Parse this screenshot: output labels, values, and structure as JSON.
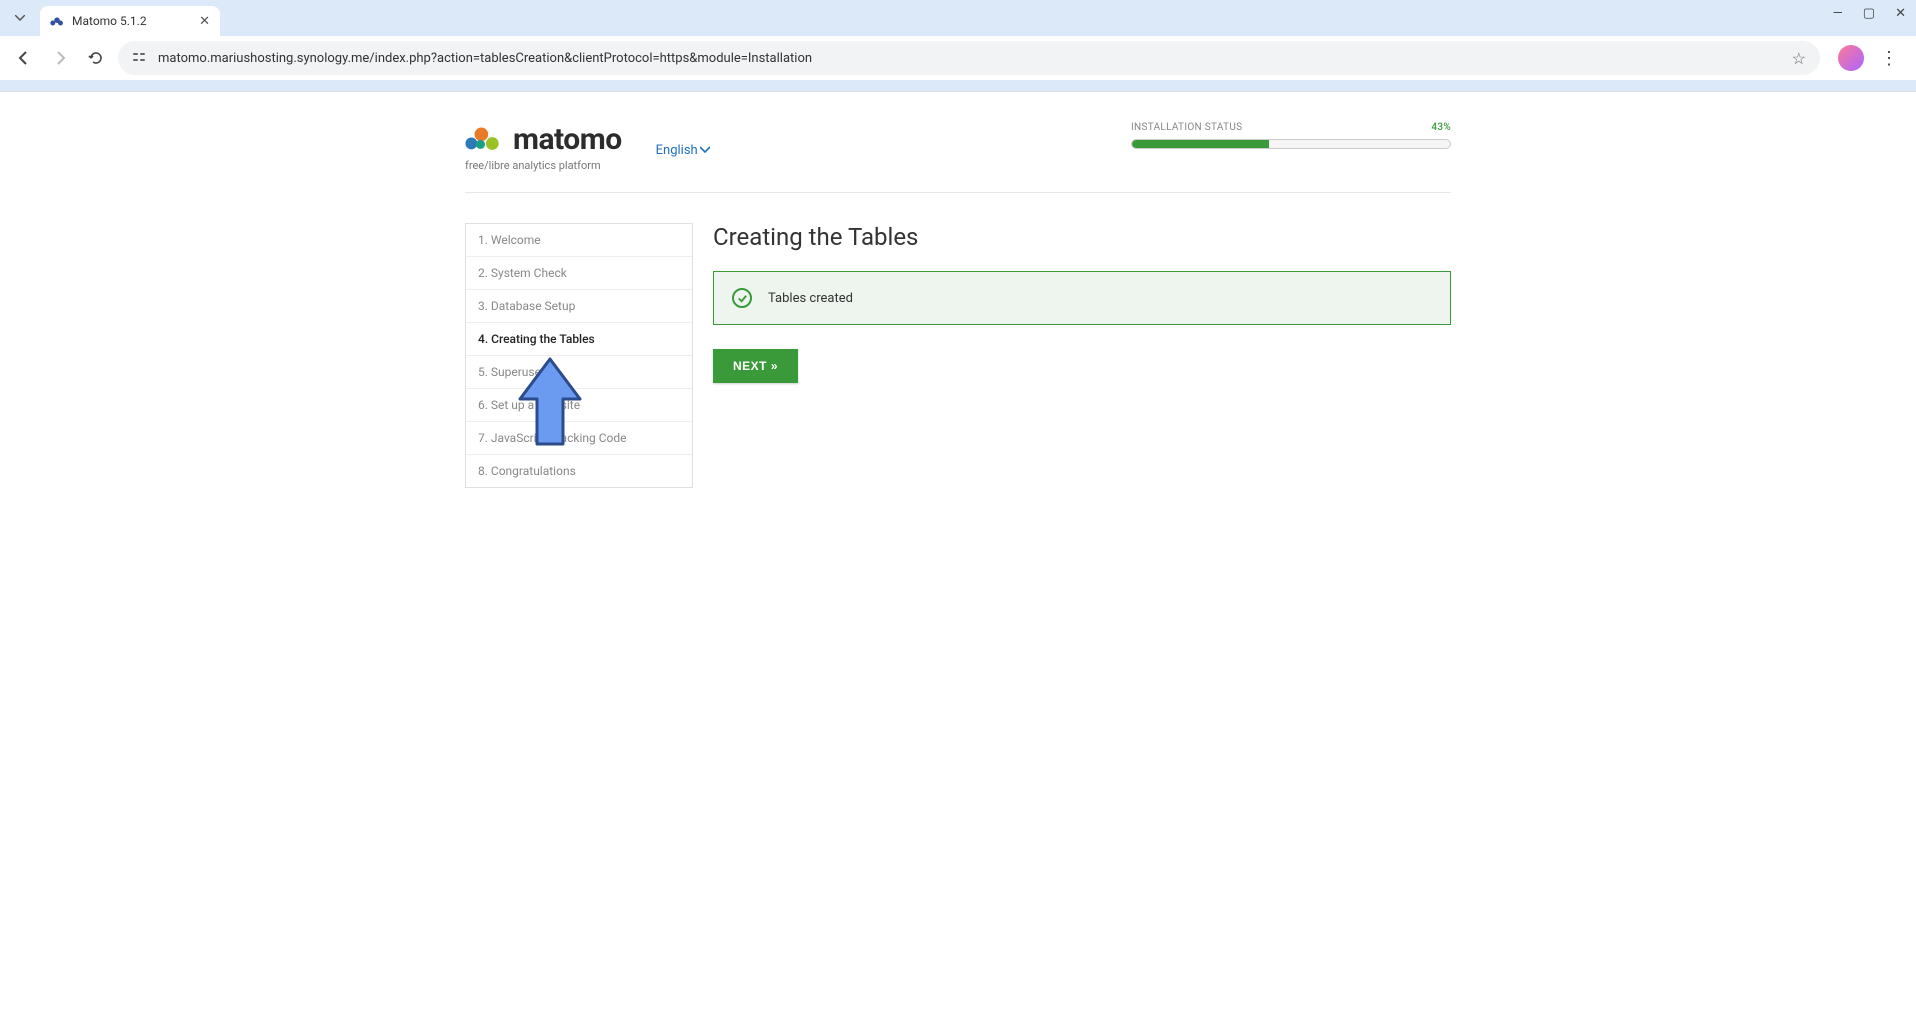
{
  "browser": {
    "tab_title": "Matomo 5.1.2",
    "url": "matomo.mariushosting.synology.me/index.php?action=tablesCreation&clientProtocol=https&module=Installation"
  },
  "header": {
    "brand": "matomo",
    "tagline": "free/libre analytics platform",
    "language": "English"
  },
  "status": {
    "label": "INSTALLATION STATUS",
    "percent_text": "43%",
    "percent_value": 43
  },
  "sidebar": {
    "items": [
      {
        "label": "1. Welcome",
        "active": false
      },
      {
        "label": "2. System Check",
        "active": false
      },
      {
        "label": "3. Database Setup",
        "active": false
      },
      {
        "label": "4. Creating the Tables",
        "active": true
      },
      {
        "label": "5. Superuser",
        "active": false
      },
      {
        "label": "6. Set up a Website",
        "active": false
      },
      {
        "label": "7. JavaScript Tracking Code",
        "active": false
      },
      {
        "label": "8. Congratulations",
        "active": false
      }
    ]
  },
  "main": {
    "title": "Creating the Tables",
    "success_message": "Tables created",
    "next_label": "NEXT »"
  }
}
